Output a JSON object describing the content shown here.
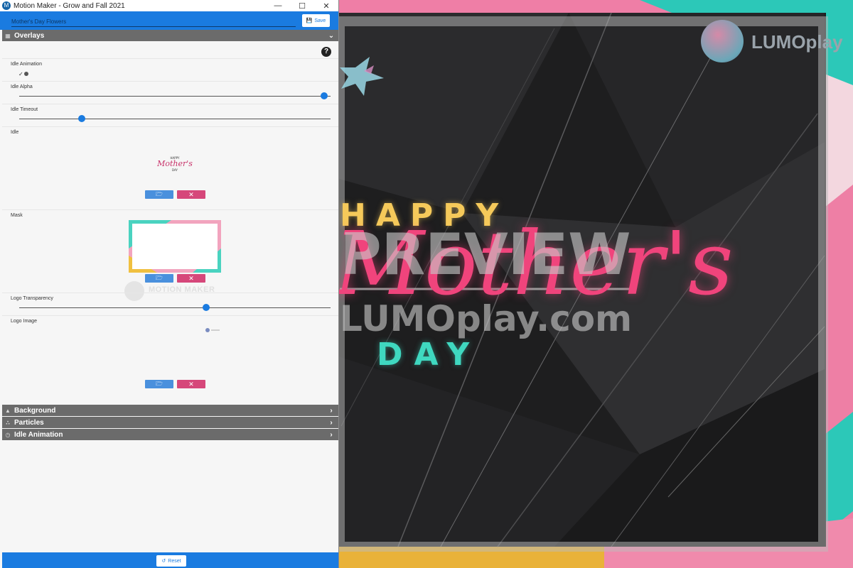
{
  "window": {
    "title": "Motion Maker - Grow and Fall 2021",
    "minimize": "—",
    "maximize": "☐",
    "close": "✕"
  },
  "toolbar": {
    "project_name": "Mother's Day Flowers",
    "save_label": "Save"
  },
  "sections": {
    "overlays": "Overlays",
    "background": "Background",
    "particles": "Particles",
    "idle_animation": "Idle Animation"
  },
  "fields": {
    "idle_animation": {
      "label": "Idle Animation",
      "checked": true
    },
    "idle_alpha": {
      "label": "Idle Alpha",
      "value_fraction": 0.98
    },
    "idle_timeout": {
      "label": "Idle Timeout",
      "value_fraction": 0.2
    },
    "idle": {
      "label": "Idle"
    },
    "mask": {
      "label": "Mask"
    },
    "logo_transparency": {
      "label": "Logo Transparency",
      "value_fraction": 0.6
    },
    "logo_image": {
      "label": "Logo Image"
    }
  },
  "idle_thumb_text": {
    "top": "HAPPY",
    "main": "Mother's",
    "bottom": "DAY"
  },
  "watermark": {
    "text": "MOTION MAKER"
  },
  "footer": {
    "reset_label": "Reset"
  },
  "preview": {
    "happy": "HAPPY",
    "mothers": "Mother's",
    "day": "DAY",
    "watermark_line1": "PREVIEW",
    "watermark_line2": "LUMOplay.com",
    "brand": "LUMOplay"
  },
  "colors": {
    "accent": "#1a7be0",
    "danger": "#d6477a",
    "section_header": "#6b6b6b"
  }
}
